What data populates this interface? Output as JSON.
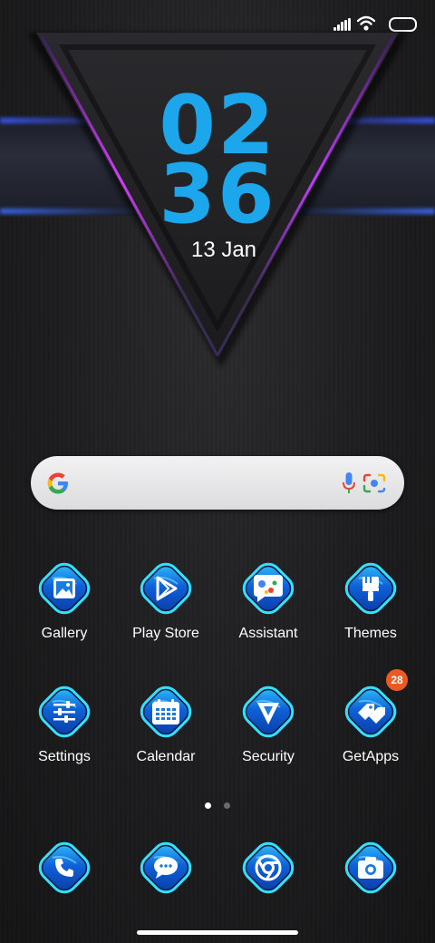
{
  "status": {
    "signal": "signal-icon",
    "wifi": "wifi-icon",
    "battery": "battery-icon"
  },
  "clock": {
    "hours": "02",
    "minutes": "36",
    "date": "13 Jan"
  },
  "search": {
    "logo": "google-g-icon",
    "mic": "mic-icon",
    "lens": "lens-icon"
  },
  "apps": [
    {
      "label": "Gallery",
      "icon": "gallery-icon"
    },
    {
      "label": "Play Store",
      "icon": "play-store-icon"
    },
    {
      "label": "Assistant",
      "icon": "assistant-icon"
    },
    {
      "label": "Themes",
      "icon": "themes-icon"
    },
    {
      "label": "Settings",
      "icon": "settings-icon"
    },
    {
      "label": "Calendar",
      "icon": "calendar-icon"
    },
    {
      "label": "Security",
      "icon": "security-icon"
    },
    {
      "label": "GetApps",
      "icon": "getapps-icon",
      "badge": "28"
    }
  ],
  "dock": [
    {
      "icon": "phone-icon"
    },
    {
      "icon": "messages-icon"
    },
    {
      "icon": "chrome-icon"
    },
    {
      "icon": "camera-icon"
    }
  ],
  "page_indicator": {
    "pages": 2,
    "current": 1
  },
  "colors": {
    "clock": "#1ca7ec",
    "accent": "#1e88f5",
    "badge": "#ec5a23",
    "glow_pink": "#c23cff"
  }
}
